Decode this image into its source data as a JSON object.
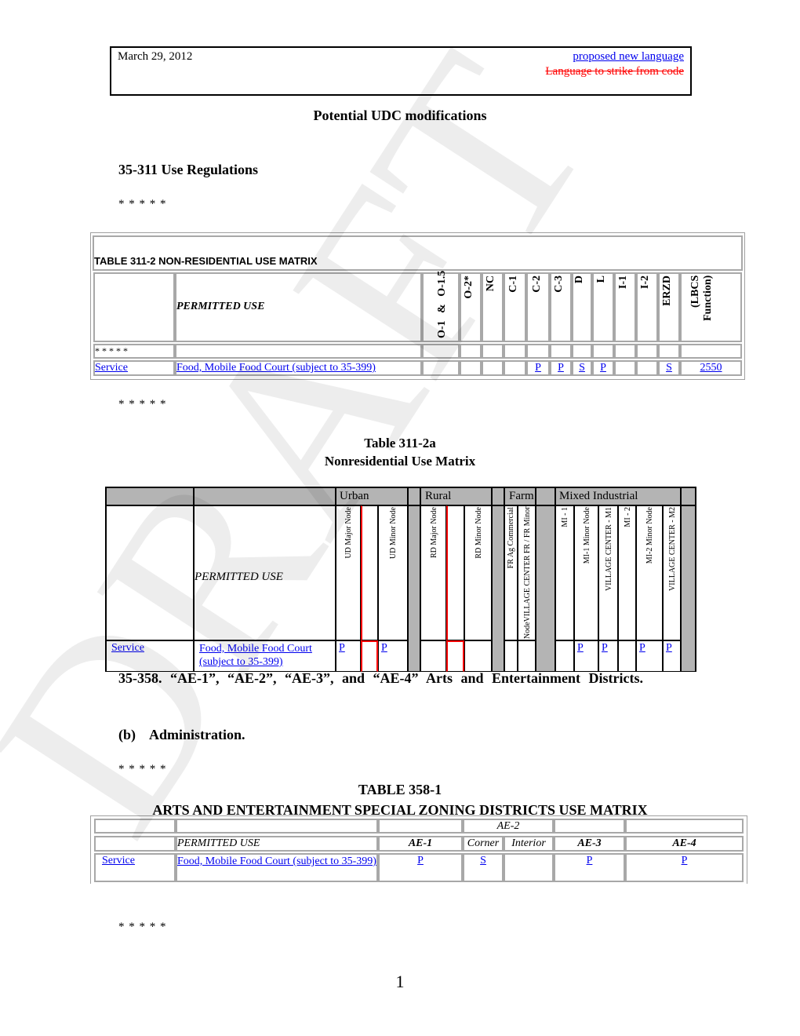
{
  "header": {
    "date": "March 29, 2012",
    "legend_new": "proposed new language",
    "legend_strike": "Language to strike from code",
    "colors": {
      "new_language": "#0000ee",
      "strike_language": "#ff0000"
    }
  },
  "doc_title": "Potential UDC modifications",
  "section_heading": "35-311 Use Regulations",
  "ellipsis": "* * * * *",
  "table_311_2": {
    "caption": "TABLE 311-2 NON-RESIDENTIAL USE MATRIX",
    "permitted_use_header": "PERMITTED USE",
    "columns": [
      "O-1 &  O-1.5",
      "O-2*",
      "NC",
      "C-1",
      "C-2",
      "C-3",
      "D",
      "L",
      "I-1",
      "I-2",
      "ERZD",
      "(LBCS Function)"
    ],
    "ellipsis_row": "* * * * *",
    "row": {
      "category": "Service",
      "use": "Food, Mobile Food Court (subject to 35-399)",
      "values": [
        "",
        "",
        "",
        "",
        "P",
        "P",
        "S",
        "P",
        "",
        "",
        "S",
        "2550"
      ]
    }
  },
  "ellipsis_2": "* * * * *",
  "table_311_2a": {
    "title_line1": "Table 311-2a",
    "title_line2": "Nonresidential Use Matrix",
    "groups": [
      "Urban",
      "Rural",
      "Farm",
      "Mixed Industrial"
    ],
    "permitted_use_header": "PERMITTED USE",
    "columns": {
      "ud_major": "UD Major Node",
      "ud_minor": "UD Minor Node",
      "rd_major": "RD Major Node",
      "rd_minor": "RD Minor  Node",
      "fr_ag": "FR Ag Commercial",
      "fr_minor": "NodeVILLAGE CENTER FR / FR Minor",
      "mi1": "MI - 1",
      "mi1_minor": "MI-1 Minor Node",
      "vc_m1": "VILLAGE CENTER - M1",
      "mi2": "MI - 2",
      "mi2_minor": "MI-2 Minor Node",
      "vc_m2": "VILLAGE CENTER - M2"
    },
    "row": {
      "category": "Service",
      "use": "Food, Mobile Food Court (subject to 35-399)",
      "values": {
        "ud_major": "P",
        "ud_minor": "P",
        "rd_major": "",
        "rd_minor": "",
        "fr_ag": "",
        "fr_minor": "",
        "mi1": "",
        "mi1_minor": "P",
        "vc_m1": "P",
        "mi2": "",
        "mi2_minor": "P",
        "vc_m2": "P"
      }
    }
  },
  "section_358": {
    "heading": "35-358.         “AE-1”,  “AE-2”,  “AE-3”,  and  “AE-4”  Arts  and  Entertainment Districts.",
    "subheading": "(b)    Administration.",
    "ellipsis": "* * * * *"
  },
  "table_358_1": {
    "title_line1": "TABLE 358-1",
    "title_line2": "ARTS AND ENTERTAINMENT SPECIAL ZONING DISTRICTS USE MATRIX",
    "group_header": "AE-2",
    "permitted_use_header": "PERMITTED USE",
    "columns": [
      "AE-1",
      "Corner",
      "Interior",
      "AE-3",
      "AE-4"
    ],
    "row": {
      "category": "Service",
      "use": "Food, Mobile Food Court (subject to 35-399)",
      "values": [
        "P",
        "S",
        "",
        "P",
        "P"
      ]
    }
  },
  "ellipsis_end": "* * * * *",
  "page_number": "1",
  "watermark": "DRAFT"
}
